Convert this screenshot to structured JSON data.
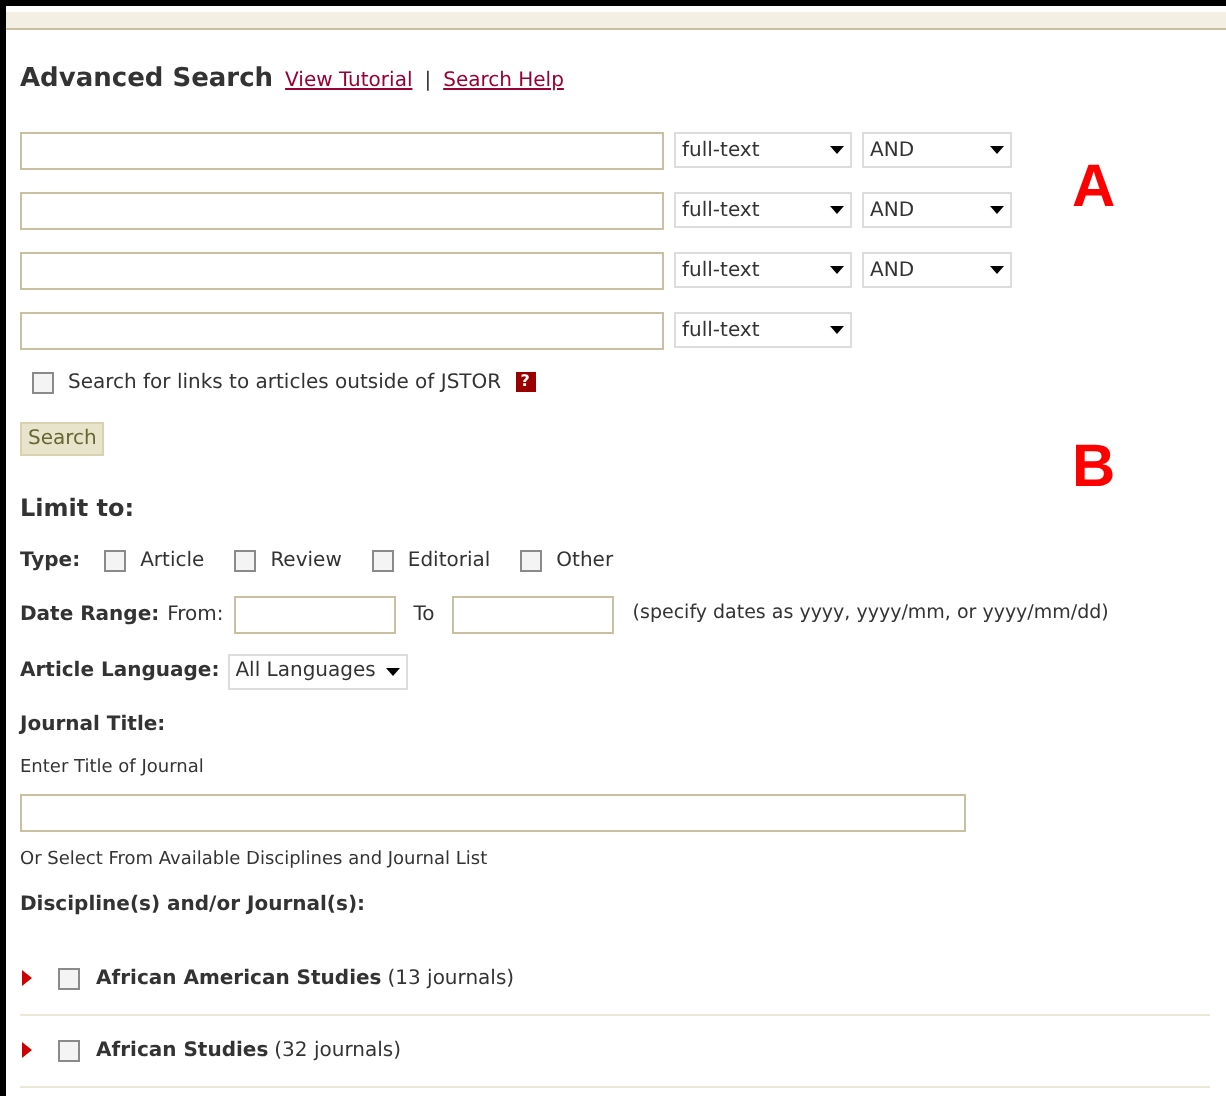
{
  "header": {
    "title": "Advanced Search",
    "links": [
      "View Tutorial",
      "Search Help"
    ],
    "separator": "|"
  },
  "search_rows": [
    {
      "field": "full-text",
      "operator": "AND"
    },
    {
      "field": "full-text",
      "operator": "AND"
    },
    {
      "field": "full-text",
      "operator": "AND"
    },
    {
      "field": "full-text"
    }
  ],
  "outside_links": {
    "label": "Search for links to articles outside of JSTOR",
    "checked": false,
    "help": "?"
  },
  "search_button": "Search",
  "annotations": [
    "A",
    "B"
  ],
  "limit": {
    "title": "Limit to:",
    "type": {
      "label": "Type:",
      "options": [
        {
          "label": "Article",
          "checked": false
        },
        {
          "label": "Review",
          "checked": false
        },
        {
          "label": "Editorial",
          "checked": false
        },
        {
          "label": "Other",
          "checked": false
        }
      ]
    },
    "date_range": {
      "label": "Date Range:",
      "from": "From:",
      "to": "To",
      "hint": "(specify dates as yyyy, yyyy/mm, or yyyy/mm/dd)"
    },
    "language": {
      "label": "Article Language:",
      "value": "All Languages"
    },
    "journal_title": {
      "label": "Journal Title:",
      "hint": "Enter Title of Journal"
    },
    "or_select": "Or Select From Available Disciplines and Journal List",
    "disciplines_label": "Discipline(s) and/or Journal(s):",
    "disciplines": [
      {
        "name": "African American Studies",
        "count": "(13 journals)",
        "checked": false,
        "expanded": false
      },
      {
        "name": "African Studies",
        "count": "(32 journals)",
        "checked": false,
        "expanded": false
      }
    ]
  }
}
